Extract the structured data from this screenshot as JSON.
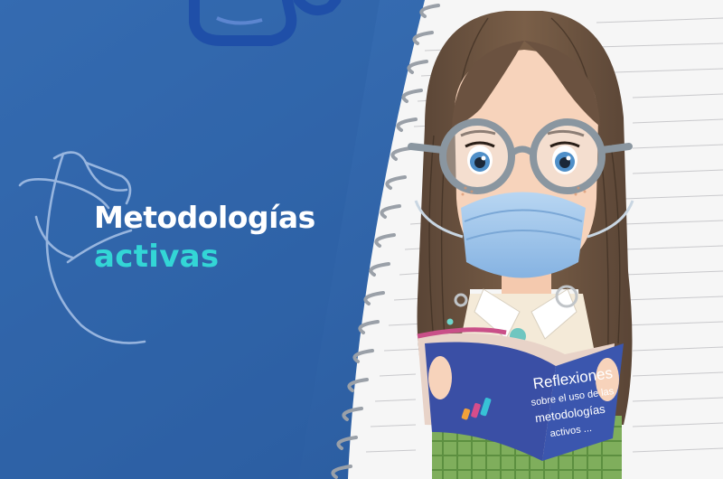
{
  "headline": {
    "line1": "Metodologías",
    "line2": "activas"
  },
  "book": {
    "cover_lines": [
      "Reflexiones",
      "sobre el uso de las",
      "metodologías",
      "activos ..."
    ]
  },
  "colors": {
    "cover_blue": "#2f63a8",
    "accent": "#33d6d6",
    "paper": "#f7f7f7",
    "book_blue": "#3a4fa5"
  },
  "icons": {
    "logo": "scribble-logo-icon",
    "brand_marks": "color-bars-icon"
  }
}
